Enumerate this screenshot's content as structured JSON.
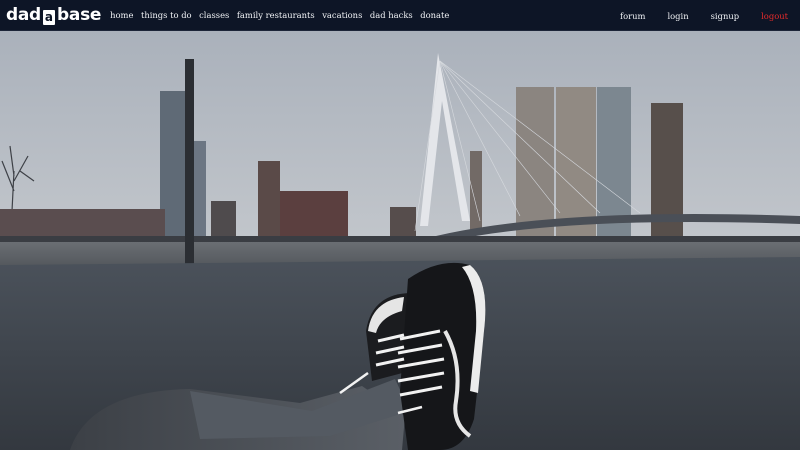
{
  "logo": {
    "pre": "dad",
    "box": "a",
    "post": "base"
  },
  "nav": {
    "left": [
      {
        "id": "home",
        "label": "home"
      },
      {
        "id": "things-to-do",
        "label": "things to do"
      },
      {
        "id": "classes",
        "label": "classes"
      },
      {
        "id": "family-restaurants",
        "label": "family restaurants"
      },
      {
        "id": "vacations",
        "label": "vacations"
      },
      {
        "id": "dad-hacks",
        "label": "dad hacks"
      },
      {
        "id": "donate",
        "label": "donate"
      }
    ],
    "right": [
      {
        "id": "forum",
        "label": "forum"
      },
      {
        "id": "login",
        "label": "login"
      },
      {
        "id": "signup",
        "label": "signup"
      },
      {
        "id": "logout",
        "label": "logout"
      }
    ]
  },
  "colors": {
    "nav_bg": "#0d1526",
    "nav_text": "#f1f3f6",
    "logout": "#e62b2b"
  }
}
